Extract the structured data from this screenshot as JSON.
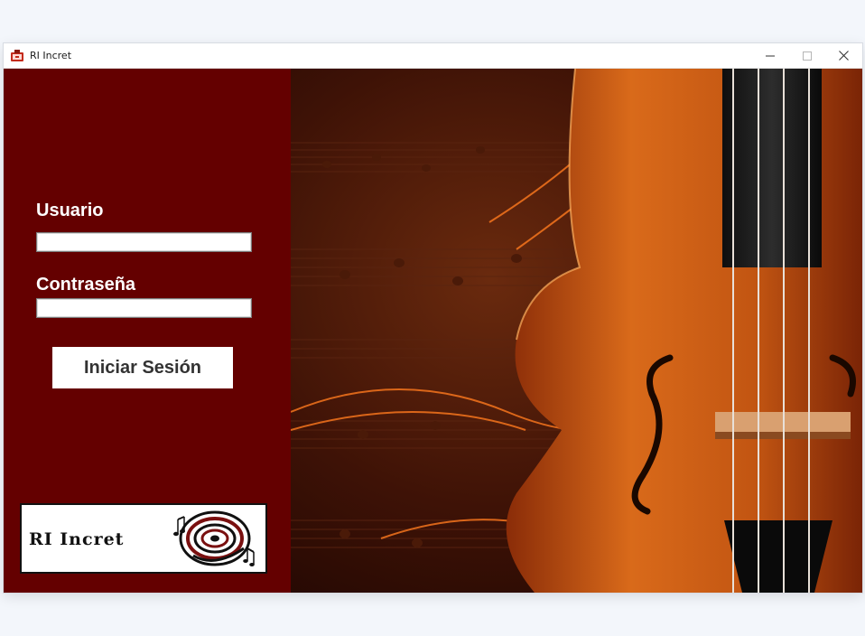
{
  "window": {
    "title": "RI Incret",
    "controls": {
      "minimize_icon": "minimize-icon",
      "maximize_icon": "maximize-icon",
      "close_icon": "close-icon"
    }
  },
  "login": {
    "user_label": "Usuario",
    "user_value": "",
    "password_label": "Contraseña",
    "password_value": "",
    "submit_label": "Iniciar Sesión"
  },
  "logo": {
    "text": "RI Incret"
  },
  "colors": {
    "panel_bg": "#640000",
    "label_text": "#ffffff",
    "button_bg": "#ffffff",
    "button_text": "#333333"
  },
  "background_image": {
    "subject": "violin-over-sheet-music"
  }
}
